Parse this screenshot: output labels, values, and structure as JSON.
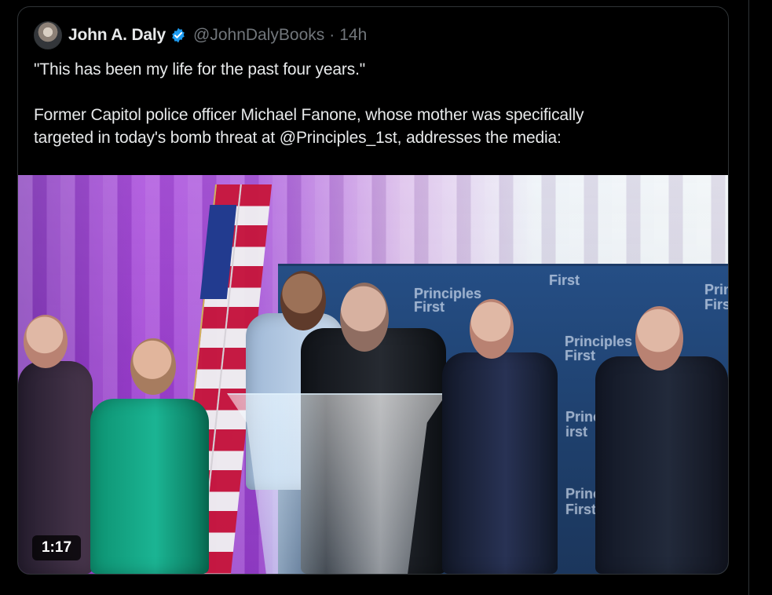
{
  "tweet": {
    "author_name": "John A. Daly",
    "handle": "@JohnDalyBooks",
    "separator": "·",
    "time": "14h",
    "text_lines": [
      "\"This has been my life for the past four years.\"",
      "Former Capitol police officer Michael Fanone, whose mother was specifically",
      "targeted in today's bomb threat at @Principles_1st, addresses the media:"
    ],
    "verified_color": "#1d9bf0",
    "avatar_icon": "profile-avatar-icon"
  },
  "media": {
    "video_duration": "1:17",
    "backdrop_logo_texts": [
      "Principles",
      "First",
      "Principles",
      "First",
      "Princi",
      "First",
      "Principles",
      "First",
      "Principl",
      "irst",
      "Princi",
      "First"
    ]
  }
}
